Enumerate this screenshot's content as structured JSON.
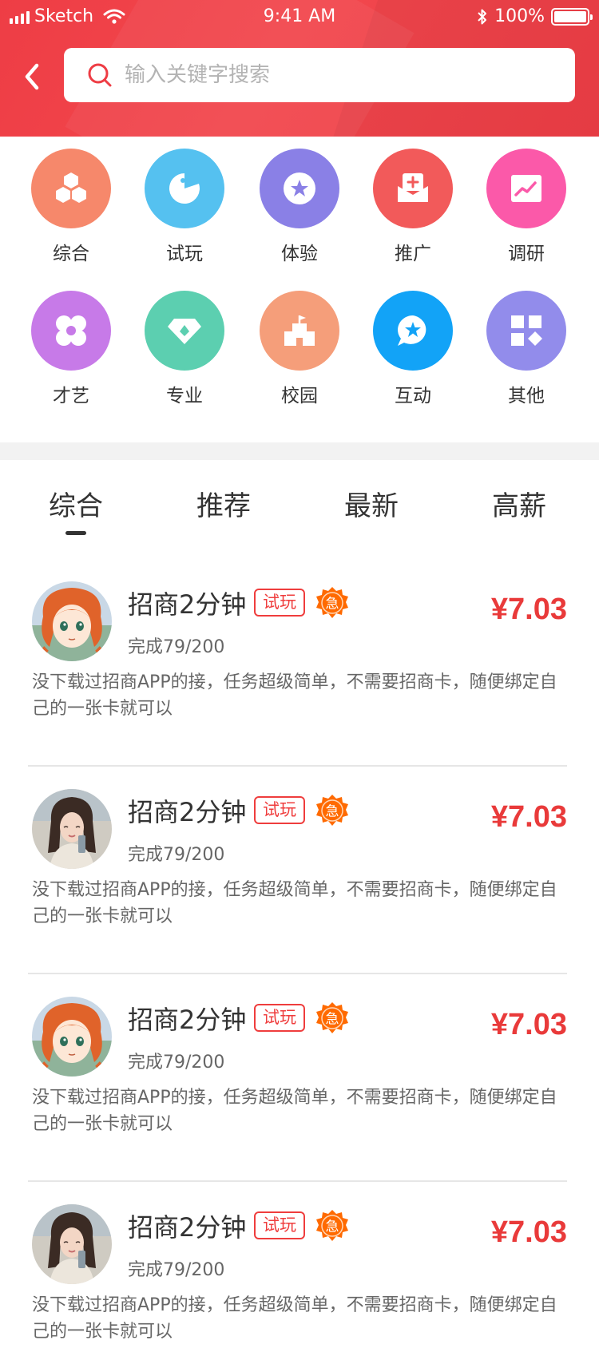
{
  "status_bar": {
    "carrier": "Sketch",
    "time": "9:41 AM",
    "battery": "100%"
  },
  "search": {
    "placeholder": "输入关键字搜索"
  },
  "categories": [
    {
      "label": "综合",
      "icon": "cubes-icon",
      "color": "#f6886b"
    },
    {
      "label": "试玩",
      "icon": "pacman-icon",
      "color": "#55c1f0"
    },
    {
      "label": "体验",
      "icon": "star-badge-icon",
      "color": "#8a80e6"
    },
    {
      "label": "推广",
      "icon": "envelope-plus-icon",
      "color": "#f25a5a"
    },
    {
      "label": "调研",
      "icon": "chart-card-icon",
      "color": "#fb59a9"
    },
    {
      "label": "才艺",
      "icon": "flower-icon",
      "color": "#c77ae8"
    },
    {
      "label": "专业",
      "icon": "diamond-icon",
      "color": "#5ccfb0"
    },
    {
      "label": "校园",
      "icon": "school-flag-icon",
      "color": "#f59e7a"
    },
    {
      "label": "互动",
      "icon": "chat-star-icon",
      "color": "#12a3f7"
    },
    {
      "label": "其他",
      "icon": "grid-apps-icon",
      "color": "#928ceb"
    }
  ],
  "tabs": [
    {
      "label": "综合",
      "active": true
    },
    {
      "label": "推荐",
      "active": false
    },
    {
      "label": "最新",
      "active": false
    },
    {
      "label": "高薪",
      "active": false
    }
  ],
  "tasks": [
    {
      "title": "招商2分钟",
      "tag": "试玩",
      "badge": "急",
      "progress": "完成79/200",
      "price": "¥7.03",
      "description": "没下载过招商APP的接，任务超级简单，不需要招商卡，随便绑定自己的一张卡就可以",
      "avatar": "cartoon-girl-avatar"
    },
    {
      "title": "招商2分钟",
      "tag": "试玩",
      "badge": "急",
      "progress": "完成79/200",
      "price": "¥7.03",
      "description": "没下载过招商APP的接，任务超级简单，不需要招商卡，随便绑定自己的一张卡就可以",
      "avatar": "photo-girl-avatar"
    },
    {
      "title": "招商2分钟",
      "tag": "试玩",
      "badge": "急",
      "progress": "完成79/200",
      "price": "¥7.03",
      "description": "没下载过招商APP的接，任务超级简单，不需要招商卡，随便绑定自己的一张卡就可以",
      "avatar": "cartoon-girl-avatar"
    },
    {
      "title": "招商2分钟",
      "tag": "试玩",
      "badge": "急",
      "progress": "完成79/200",
      "price": "¥7.03",
      "description": "没下载过招商APP的接，任务超级简单，不需要招商卡，随便绑定自己的一张卡就可以",
      "avatar": "photo-girl-avatar"
    }
  ],
  "colors": {
    "brand_red": "#ee3d45",
    "price_red": "#e93a3a",
    "badge_orange": "#ff6a00"
  }
}
